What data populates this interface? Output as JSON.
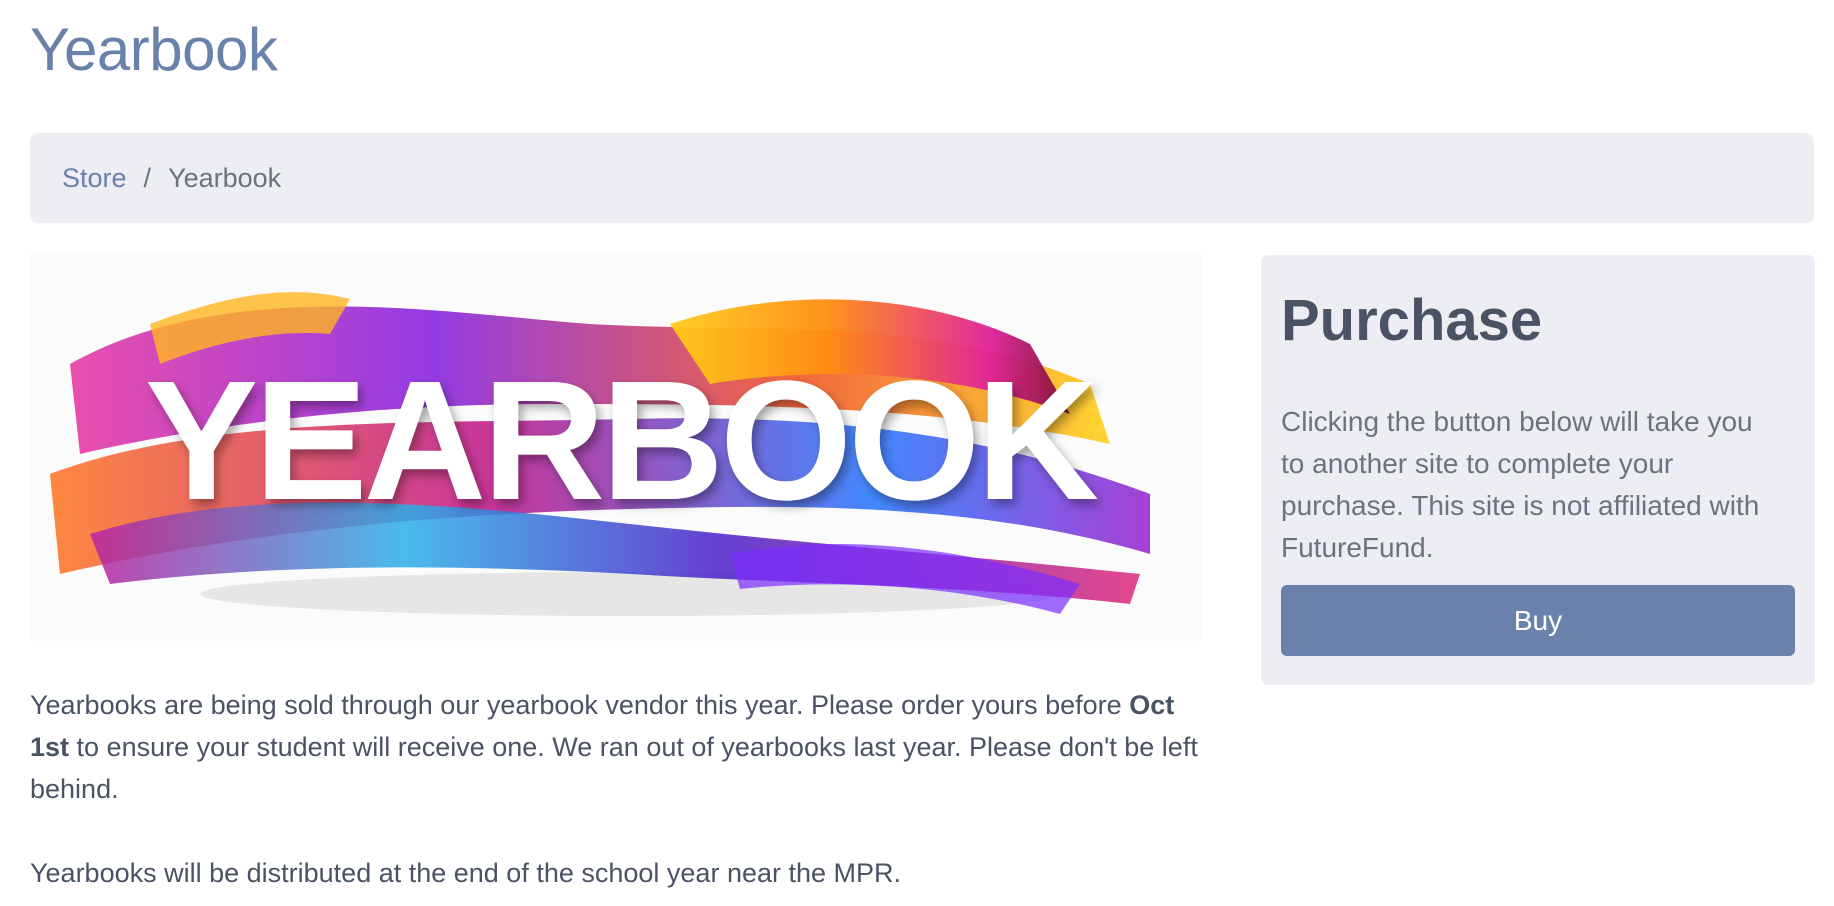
{
  "header": {
    "title": "Yearbook"
  },
  "breadcrumb": {
    "store_label": "Store",
    "separator": "/",
    "current_label": "Yearbook"
  },
  "hero": {
    "text": "YEARBOOK"
  },
  "description": {
    "line1_before": "Yearbooks are being sold through our yearbook vendor this year.  Please order yours before ",
    "deadline": "Oct 1st",
    "line1_after": " to ensure your student will receive one.  We ran out of yearbooks last year.  Please don't be left behind.",
    "line2": "Yearbooks will be distributed at the end of the school year near the MPR."
  },
  "purchase": {
    "title": "Purchase",
    "text": "Clicking the button below will take you to another site to complete your purchase. This site is not affiliated with FutureFund.",
    "button_label": "Buy"
  },
  "colors": {
    "accent": "#6a82ab",
    "panel_bg": "#eceef3",
    "text_dark": "#4a5363",
    "text_muted": "#6b7280"
  }
}
